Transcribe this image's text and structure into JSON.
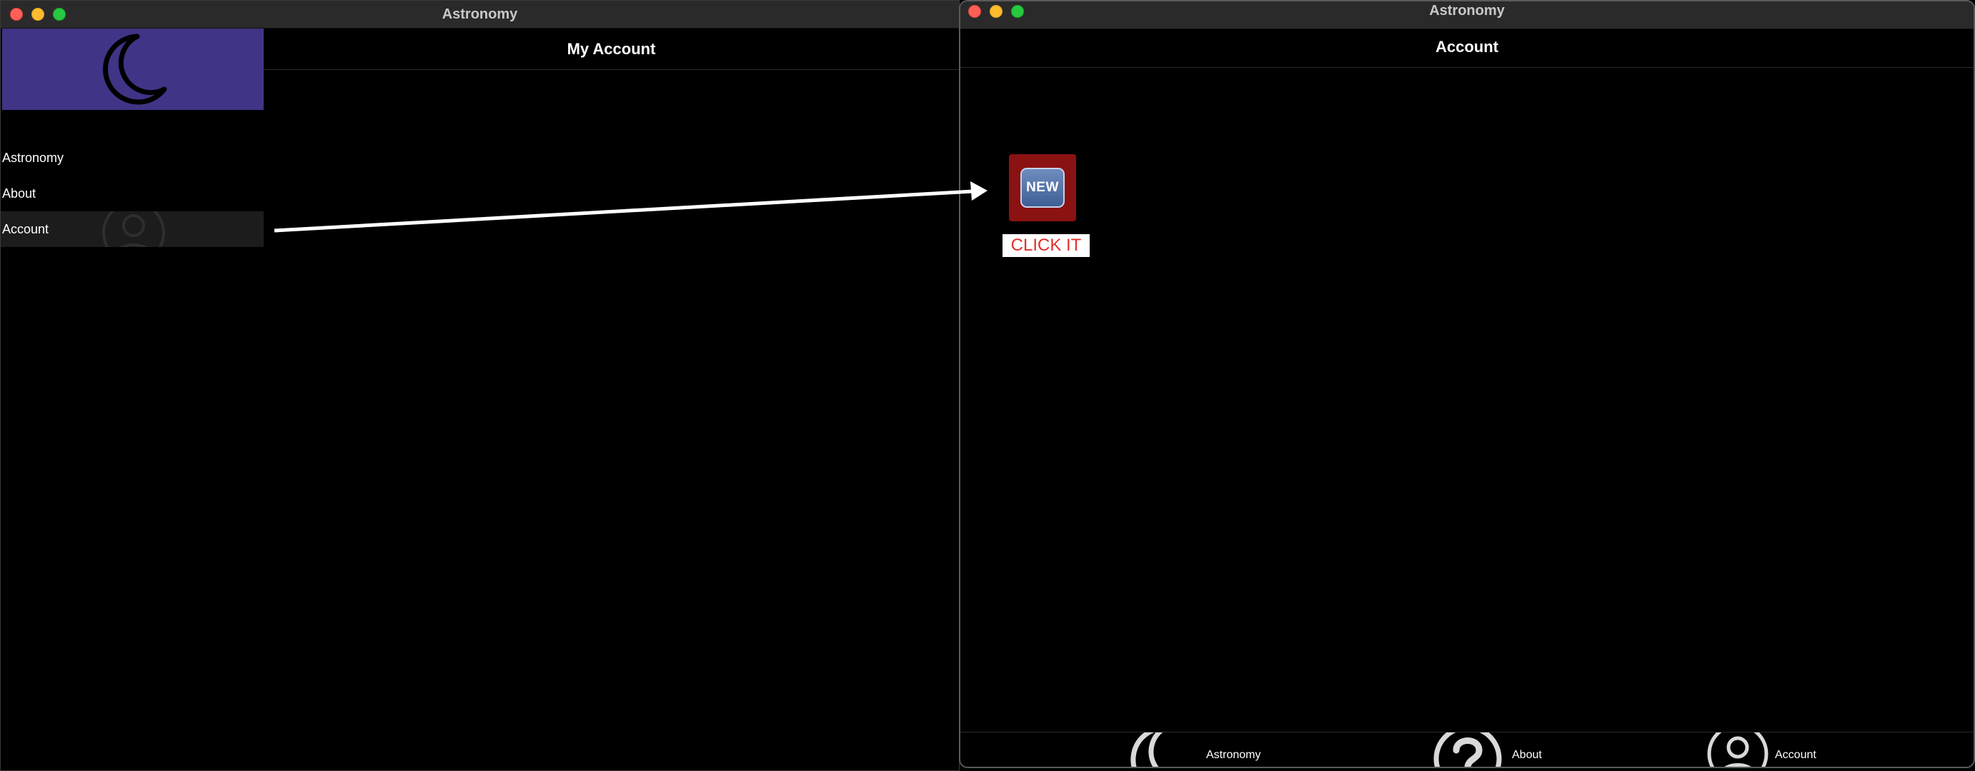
{
  "left_window": {
    "title": "Astronomy",
    "header_title": "My Account",
    "sidebar": {
      "header_icon": "moon-icon",
      "items": [
        {
          "label": "Astronomy",
          "selected": false
        },
        {
          "label": "About",
          "selected": false
        },
        {
          "label": "Account",
          "selected": true,
          "icon": "person-circle-icon"
        }
      ]
    }
  },
  "right_window": {
    "title": "Account",
    "window_title": "Astronomy",
    "new_button": {
      "badge_text": "NEW",
      "icon": "new-badge-icon"
    },
    "callout": "CLICK IT",
    "tabs": [
      {
        "label": "Astronomy",
        "icon": "moon-icon"
      },
      {
        "label": "About",
        "icon": "question-circle-icon"
      },
      {
        "label": "Account",
        "icon": "person-circle-icon"
      }
    ]
  },
  "colors": {
    "sidebar_header": "#3f3486",
    "tile": "#8b1212",
    "callout_text": "#e0302d",
    "titlebar": "#2a2a2b"
  }
}
